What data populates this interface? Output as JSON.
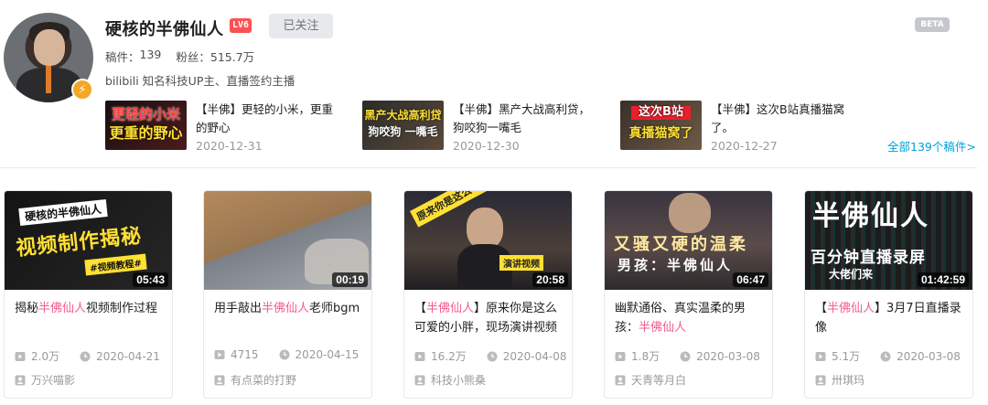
{
  "user": {
    "name": "硬核的半佛仙人",
    "level": "LV6",
    "follow_label": "已关注",
    "beta": "BETA",
    "videos_label": "稿件：",
    "videos_count": "139",
    "fans_label": "粉丝：",
    "fans_count": "515.7万",
    "bio": "bilibili 知名科技UP主、直播签约主播"
  },
  "recent": [
    {
      "title": "【半佛】更轻的小米，更重的野心",
      "date": "2020-12-31",
      "thumb_line1": "更轻的小米",
      "thumb_line2": "更重的野心"
    },
    {
      "title": "【半佛】黑产大战高利贷，狗咬狗一嘴毛",
      "date": "2020-12-30",
      "thumb_line1": "黑产大战高利贷",
      "thumb_line2": "狗咬狗 一嘴毛"
    },
    {
      "title": "【半佛】这次B站真播猫窝了。",
      "date": "2020-12-27",
      "thumb_line1": "这次B站",
      "thumb_line2": "真播猫窝了"
    }
  ],
  "all_link": "全部139个稿件>",
  "cards": [
    {
      "duration": "05:43",
      "title_pre": "揭秘",
      "title_hl": "半佛仙人",
      "title_post": "视频制作过程",
      "plays": "2.0万",
      "date": "2020-04-21",
      "uploader": "万兴喵影",
      "cover_line1": "硬核的半佛仙人",
      "cover_line2": "视频制作揭秘",
      "cover_tag": "#视频教程#"
    },
    {
      "duration": "00:19",
      "title_pre": "用手敲出",
      "title_hl": "半佛仙人",
      "title_post": "老师bgm",
      "plays": "4715",
      "date": "2020-04-15",
      "uploader": "有点菜的打野"
    },
    {
      "duration": "20:58",
      "title_pre": "【",
      "title_hl": "半佛仙人",
      "title_post": "】原来你是这么可爱的小胖，现场演讲视频",
      "plays": "16.2万",
      "date": "2020-04-08",
      "uploader": "科技小熊桑",
      "cover_line1": "原来你是这么可爱的小胖",
      "cover_tag": "演讲视频"
    },
    {
      "duration": "06:47",
      "title_pre": "幽默通俗、真实温柔的男孩：",
      "title_hl": "半佛仙人",
      "title_post": "",
      "plays": "1.8万",
      "date": "2020-03-08",
      "uploader": "天青等月白",
      "cover_line1": "又骚又硬的温柔",
      "cover_line2": "男孩：半佛仙人"
    },
    {
      "duration": "01:42:59",
      "title_pre": "【",
      "title_hl": "半佛仙人",
      "title_post": "】3月7日直播录像",
      "plays": "5.1万",
      "date": "2020-03-08",
      "uploader": "卅琪玛",
      "cover_line1": "半佛仙人",
      "cover_line2": "百分钟直播录屏",
      "cover_line3": "大佬们来"
    }
  ],
  "icons": {
    "play": "play-count-icon",
    "clock": "clock-icon",
    "uploader": "uploader-icon",
    "verify": "lightning-verify-icon"
  },
  "colors": {
    "highlight": "#f25d8e",
    "link": "#00a1d6",
    "level": "#fb5151",
    "verify": "#f5a623"
  }
}
